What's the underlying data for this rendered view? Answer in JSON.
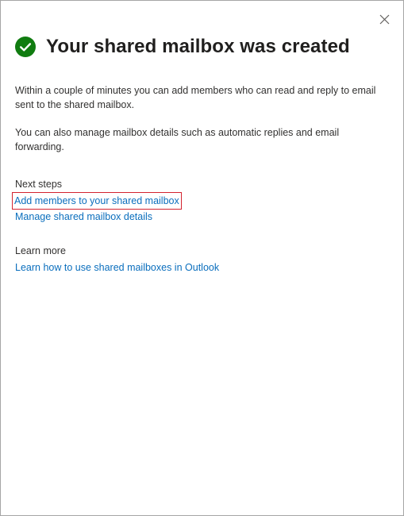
{
  "dialog": {
    "title": "Your shared mailbox was created",
    "close_icon": "close-icon",
    "status_icon": "success-checkmark-icon",
    "status_color": "#107c10",
    "link_color": "#0a6ebd",
    "highlight_color": "#d3232f"
  },
  "body": {
    "paragraph_1": "Within a couple of minutes you can add members who can read and reply to email sent to the shared mailbox.",
    "paragraph_2": "You can also manage mailbox details such as automatic replies and email forwarding."
  },
  "next_steps": {
    "heading": "Next steps",
    "links": [
      {
        "label": "Add members to your shared mailbox"
      },
      {
        "label": "Manage shared mailbox details"
      }
    ]
  },
  "learn_more": {
    "heading": "Learn more",
    "links": [
      {
        "label": "Learn how to use shared mailboxes in Outlook"
      }
    ]
  }
}
